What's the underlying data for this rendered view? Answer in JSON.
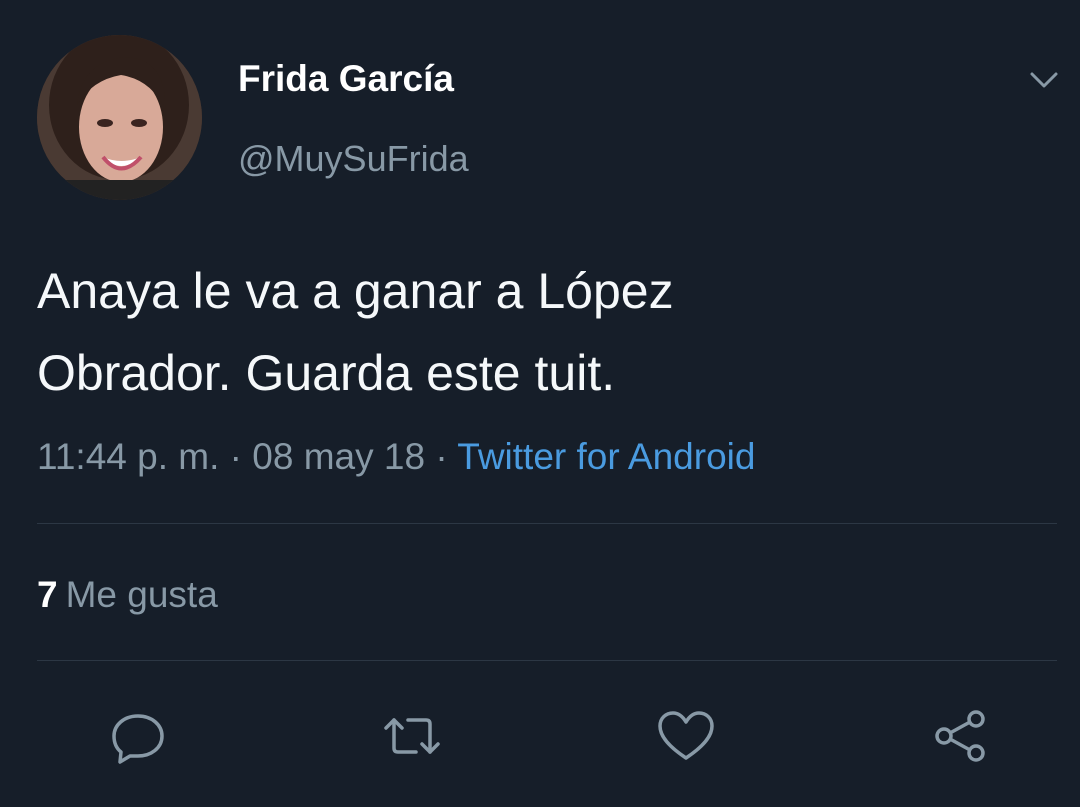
{
  "user": {
    "display_name": "Frida García",
    "handle": "@MuySuFrida"
  },
  "tweet": {
    "text_line1": "Anaya le va a ganar a López",
    "text_line2": "Obrador. Guarda este tuit.",
    "time": "11:44 p. m.",
    "date": "08 may 18",
    "source": "Twitter for Android",
    "separator": " · "
  },
  "stats": {
    "likes_count": "7",
    "likes_label": "Me gusta"
  },
  "icons": {
    "menu": "chevron-down-icon",
    "reply": "reply-icon",
    "retweet": "retweet-icon",
    "like": "heart-icon",
    "share": "share-icon"
  },
  "colors": {
    "background": "#161e29",
    "primary_text": "#ffffff",
    "secondary_text": "#8899a6",
    "link": "#4a9be0",
    "divider": "#2c3744"
  }
}
